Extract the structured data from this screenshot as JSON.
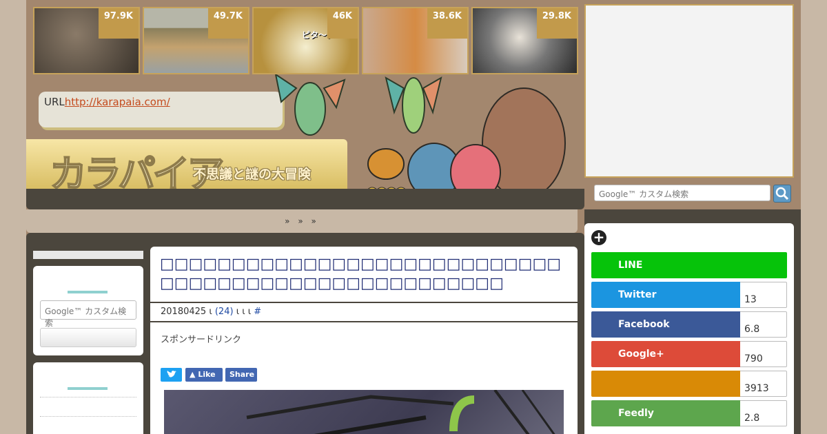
{
  "thumbnails": [
    {
      "count": "97.9K",
      "caption": ""
    },
    {
      "count": "49.7K",
      "caption": ""
    },
    {
      "count": "46K",
      "caption": "ピタ〜ン"
    },
    {
      "count": "38.6K",
      "caption": ""
    },
    {
      "count": "29.8K",
      "caption": ""
    }
  ],
  "header": {
    "url_prefix": "URL",
    "url_link": "http://karapaia.com/",
    "logo": "カラパイア",
    "tagline": "不思議と謎の大冒険"
  },
  "breadcrumb": "»  »  »",
  "search": {
    "placeholder": "Google™ カスタム検索"
  },
  "left_sidebar": {
    "search_placeholder": "Google™ カスタム検索"
  },
  "article": {
    "title": "□□□□□□□□□□□□□□□□□□□□□□□□□□□□□□□□□□□□□□□□□□□□□□□□□□□□",
    "date": "20180425",
    "meta_sep": "ι",
    "comments": "(24)",
    "meta_tail": "ι ι ι",
    "hash": "#",
    "sponsor": "スポンサードリンク",
    "share_buttons": {
      "twitter_icon": "twitter-bird",
      "like": "Like",
      "share": "Share"
    }
  },
  "share_panel": {
    "rows": [
      {
        "label": "LINE",
        "count": "",
        "color": "#06c30a"
      },
      {
        "label": "Twitter",
        "count": "13",
        "color": "#1b95e0"
      },
      {
        "label": "Facebook",
        "count": "6.8",
        "color": "#3b5998"
      },
      {
        "label": "Google+",
        "count": "790",
        "color": "#dd4b39"
      },
      {
        "label": "",
        "count": "3913",
        "color": "#d98a06"
      },
      {
        "label": "Feedly",
        "count": "2.8",
        "color": "#5da64d"
      }
    ]
  },
  "colors": {
    "accent_gold": "#c29a4b",
    "dark": "#4b463d",
    "title_navy": "#1f2c73"
  }
}
